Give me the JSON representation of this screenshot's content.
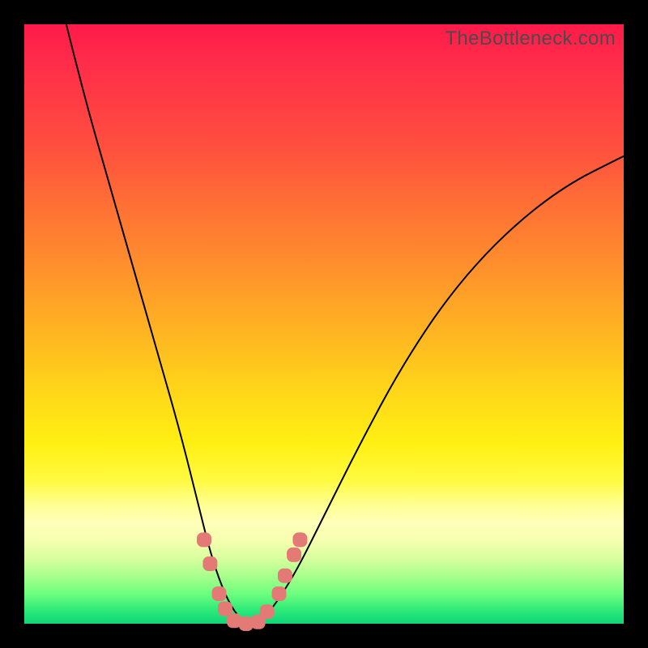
{
  "watermark": "TheBottleneck.com",
  "chart_data": {
    "type": "line",
    "title": "",
    "xlabel": "",
    "ylabel": "",
    "xlim": [
      0,
      100
    ],
    "ylim": [
      0,
      100
    ],
    "series": [
      {
        "name": "bottleneck-curve",
        "x": [
          7,
          10,
          14,
          18,
          22,
          26,
          29,
          31,
          33,
          35,
          37,
          39,
          41,
          45,
          50,
          56,
          63,
          71,
          80,
          90,
          100
        ],
        "y": [
          100,
          88,
          74,
          60,
          46,
          32,
          20,
          12,
          6,
          2,
          0,
          0,
          2,
          8,
          18,
          30,
          43,
          55,
          65,
          73,
          78
        ]
      }
    ],
    "markers": [
      {
        "x": 30.0,
        "y": 14.0
      },
      {
        "x": 31.0,
        "y": 10.0
      },
      {
        "x": 32.5,
        "y": 5.0
      },
      {
        "x": 33.5,
        "y": 2.5
      },
      {
        "x": 35.0,
        "y": 0.5
      },
      {
        "x": 37.0,
        "y": 0.0
      },
      {
        "x": 39.0,
        "y": 0.3
      },
      {
        "x": 40.5,
        "y": 2.0
      },
      {
        "x": 42.5,
        "y": 5.0
      },
      {
        "x": 43.5,
        "y": 8.0
      },
      {
        "x": 45.0,
        "y": 11.5
      },
      {
        "x": 46.0,
        "y": 14.0
      }
    ],
    "gradient_stops": [
      {
        "pos": 0,
        "color": "#ff1a4a"
      },
      {
        "pos": 50,
        "color": "#ffb023"
      },
      {
        "pos": 80,
        "color": "#ffff8f"
      },
      {
        "pos": 100,
        "color": "#11d477"
      }
    ]
  }
}
